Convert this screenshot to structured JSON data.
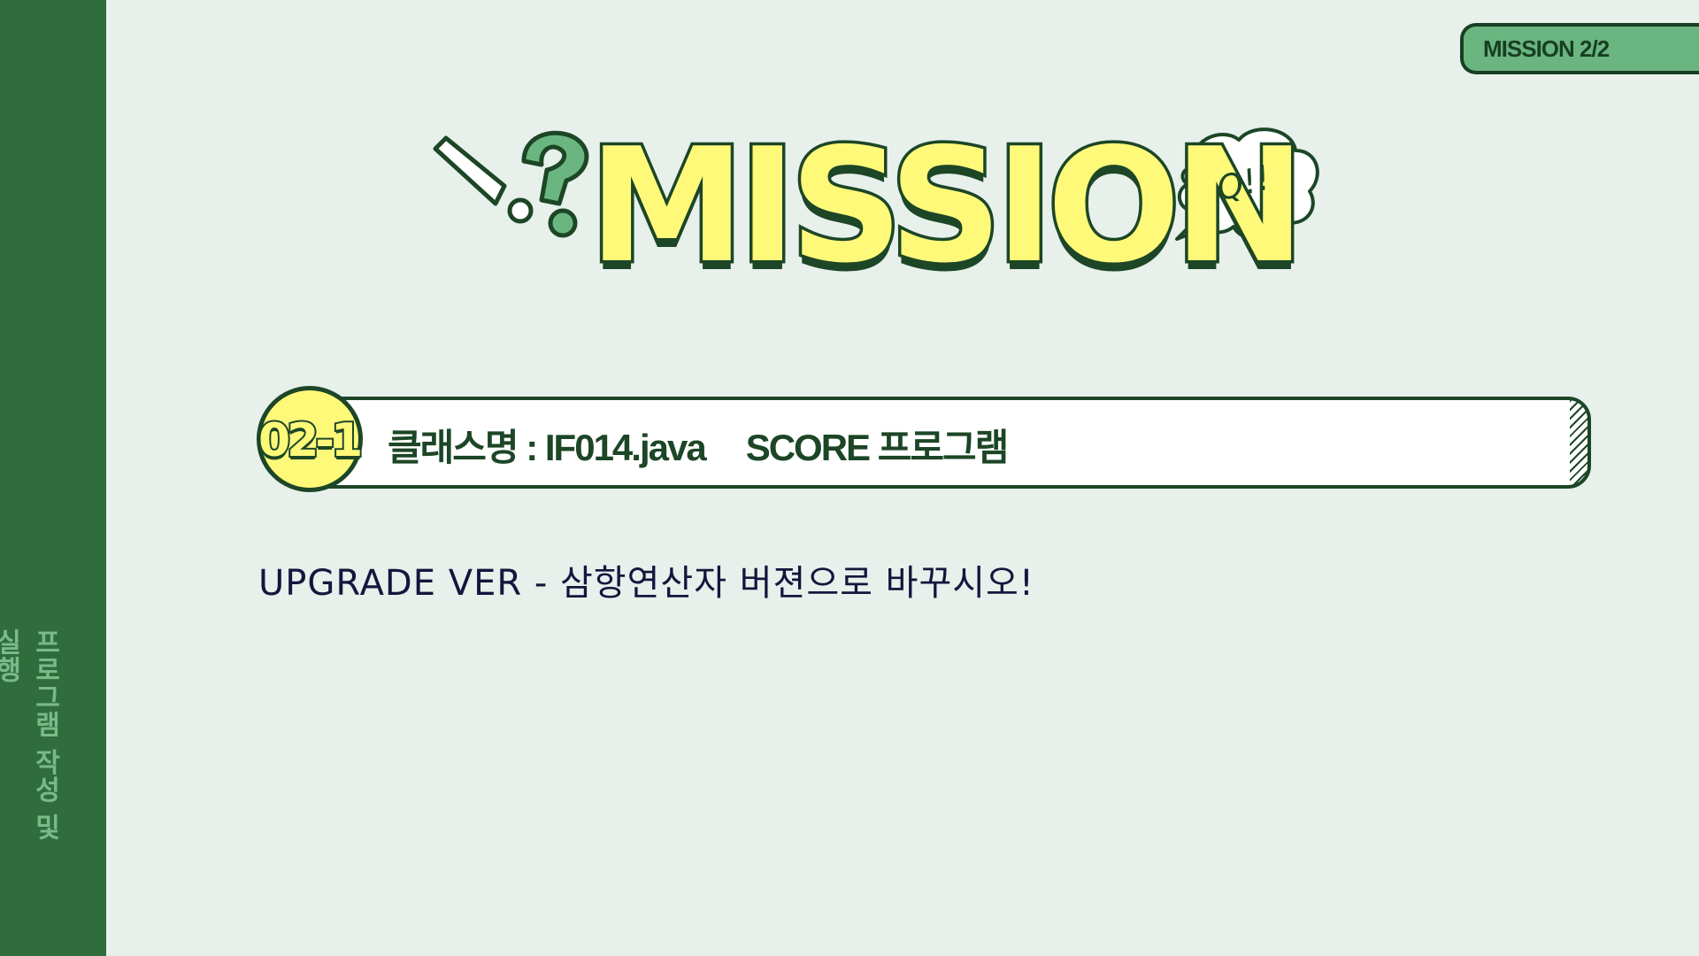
{
  "sidebar": {
    "caption": "프로그램 작성 및 실행"
  },
  "badge": {
    "label": "MISSION 2/2"
  },
  "hero": {
    "title": "MISSION",
    "bubble_text": "Q!!",
    "exclamation_icon": "exclamation-icon",
    "question_icon": "question-icon",
    "bubble_icon": "speech-bubble-icon"
  },
  "mission": {
    "number": "02-1",
    "class_label": "클래스명 : IF014.java",
    "program_label": "SCORE 프로그램"
  },
  "instruction": {
    "text": "UPGRADE VER -  삼항연산자 버젼으로 바꾸시오!"
  },
  "colors": {
    "background": "#e7f0eb",
    "sidebar": "#2f6e3c",
    "accent_green": "#6bb680",
    "yellow": "#fff97a",
    "dark_green": "#1c4626",
    "text_navy": "#14163d"
  }
}
